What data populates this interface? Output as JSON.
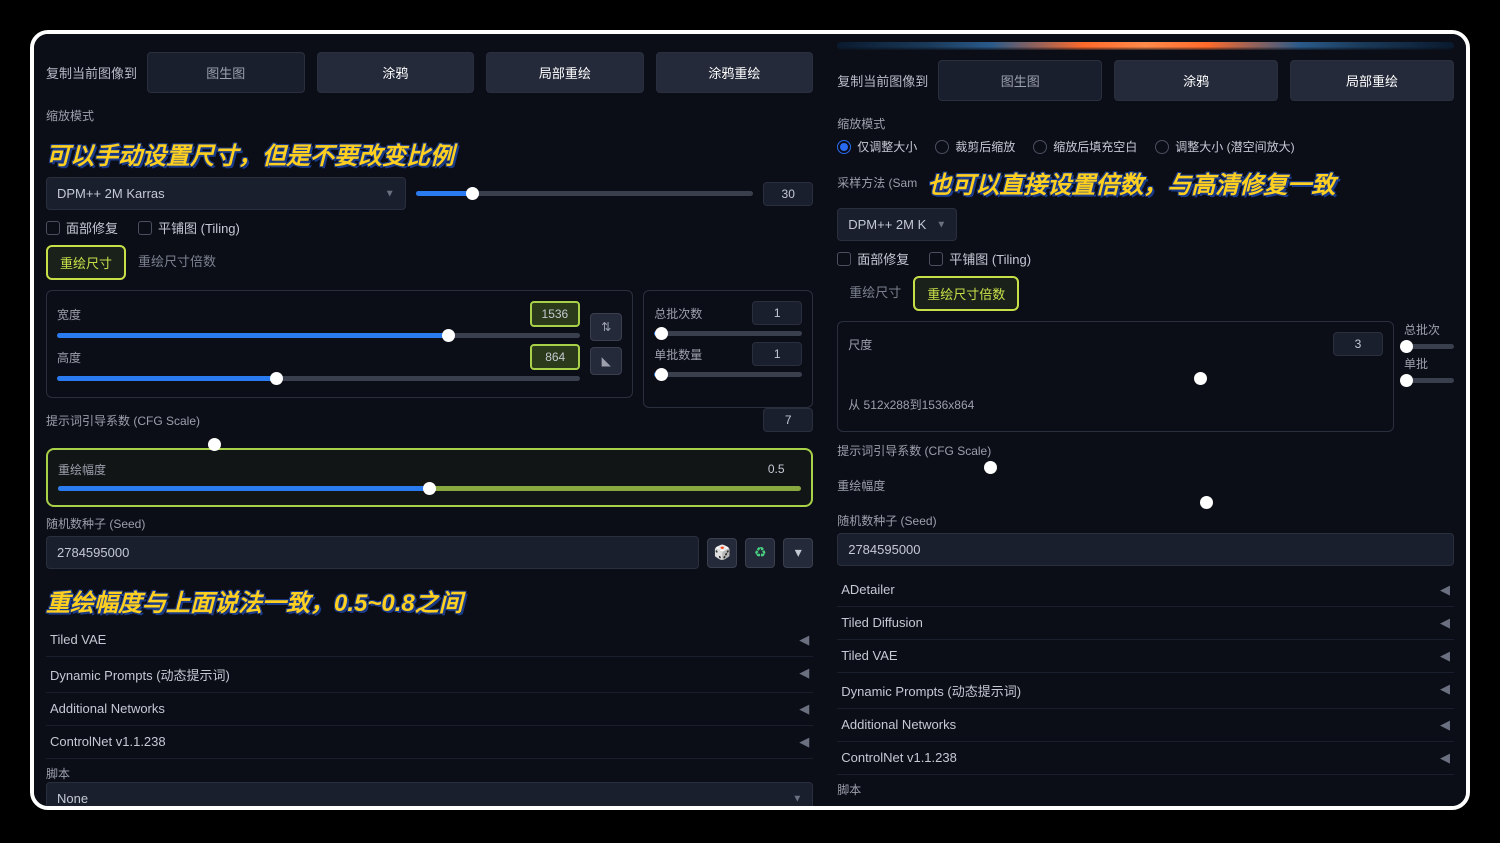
{
  "left": {
    "copyLabel": "复制当前图像到",
    "copyButtons": [
      "图生图",
      "涂鸦",
      "局部重绘",
      "涂鸦重绘"
    ],
    "zoomModeLabel": "缩放模式",
    "annotation1": "可以手动设置尺寸，但是不要改变比例",
    "sampling": {
      "method": "DPM++ 2M Karras",
      "stepsValue": "30",
      "stepsPercent": 17
    },
    "faceRestore": "面部修复",
    "tiling": "平铺图 (Tiling)",
    "tabs": {
      "size": "重绘尺寸",
      "multiplier": "重绘尺寸倍数",
      "active": "size"
    },
    "width": {
      "label": "宽度",
      "value": "1536",
      "percent": 75
    },
    "height": {
      "label": "高度",
      "value": "864",
      "percent": 42
    },
    "batchCount": {
      "label": "总批次数",
      "value": "1",
      "percent": 5
    },
    "batchSize": {
      "label": "单批数量",
      "value": "1",
      "percent": 5
    },
    "cfg": {
      "label": "提示词引导系数 (CFG Scale)",
      "value": "7",
      "percent": 22
    },
    "denoise": {
      "label": "重绘幅度",
      "value": "0.5",
      "percent": 50
    },
    "seed": {
      "label": "随机数种子 (Seed)",
      "value": "2784595000"
    },
    "annotation2": "重绘幅度与上面说法一致，0.5~0.8之间",
    "accordions": [
      "Tiled VAE",
      "Dynamic Prompts (动态提示词)",
      "Additional Networks",
      "ControlNet v1.1.238"
    ],
    "scriptLabel": "脚本",
    "scriptValue": "None"
  },
  "right": {
    "copyLabel": "复制当前图像到",
    "copyButtons": [
      "图生图",
      "涂鸦",
      "局部重绘"
    ],
    "zoomModeLabel": "缩放模式",
    "resizeModes": [
      "仅调整大小",
      "裁剪后缩放",
      "缩放后填充空白",
      "调整大小 (潜空间放大)"
    ],
    "samplingLabel": "采样方法 (Sam",
    "samplingMethod": "DPM++ 2M K",
    "annotation1": "也可以直接设置倍数，与高清修复一致",
    "faceRestore": "面部修复",
    "tiling": "平铺图 (Tiling)",
    "tabs": {
      "size": "重绘尺寸",
      "multiplier": "重绘尺寸倍数",
      "active": "multiplier"
    },
    "scale": {
      "label": "尺度",
      "value": "3",
      "percent": 66
    },
    "rangeText": "从 512x288到1536x864",
    "batchCount": {
      "label": "总批次",
      "percent": 5
    },
    "batchSize": {
      "label": "单批",
      "percent": 5
    },
    "cfg": {
      "label": "提示词引导系数 (CFG Scale)",
      "percent": 25
    },
    "denoise": {
      "label": "重绘幅度",
      "percent": 60
    },
    "seed": {
      "label": "随机数种子 (Seed)",
      "value": "2784595000"
    },
    "accordions": [
      "ADetailer",
      "Tiled Diffusion",
      "Tiled VAE",
      "Dynamic Prompts (动态提示词)",
      "Additional Networks",
      "ControlNet v1.1.238"
    ],
    "scriptLabel": "脚本"
  }
}
